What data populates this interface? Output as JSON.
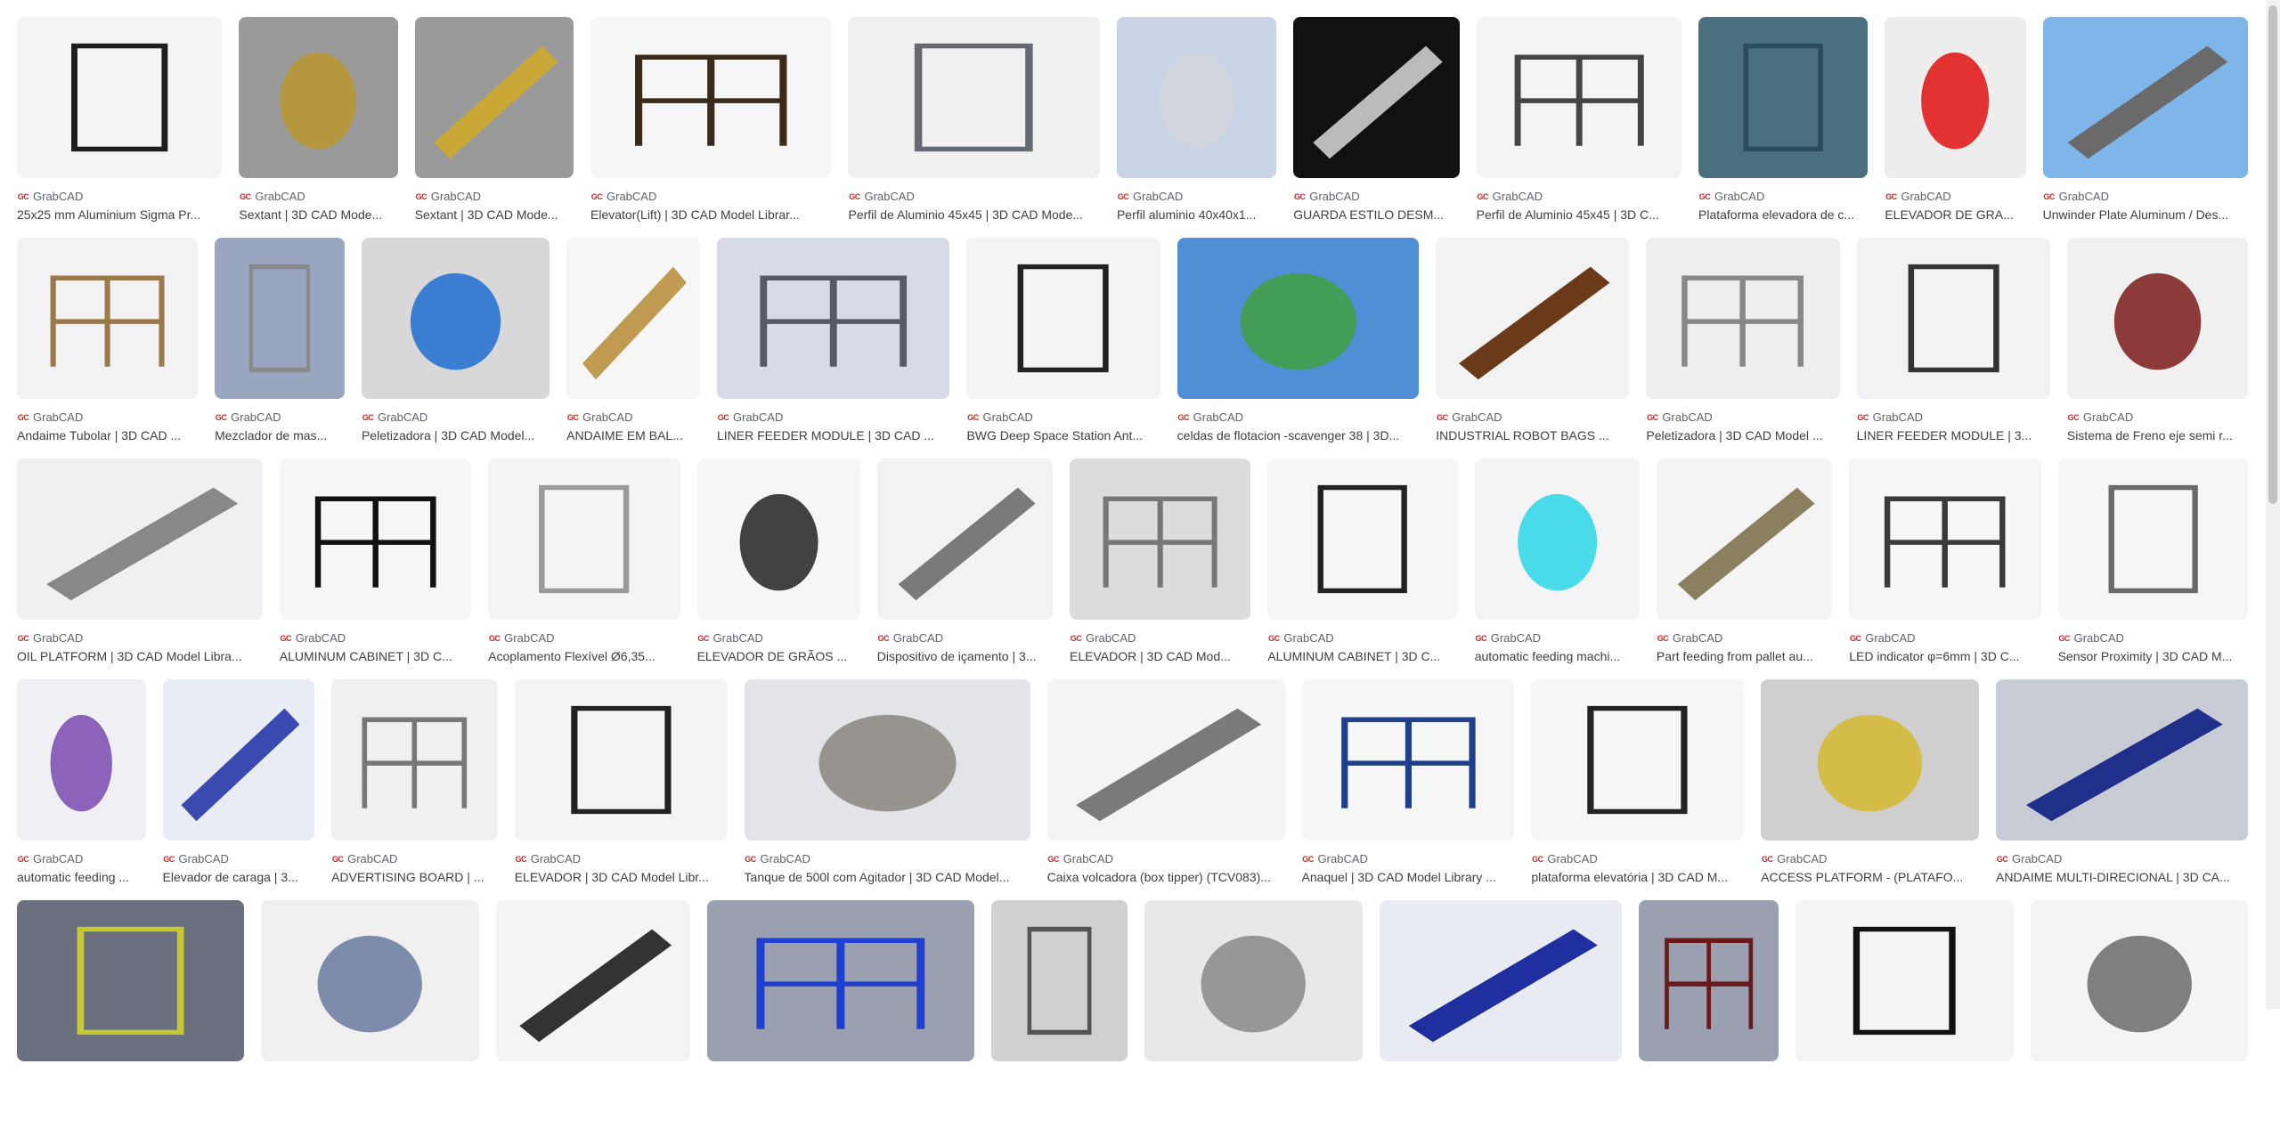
{
  "source_icon": "GC",
  "source_name": "GrabCAD",
  "colors": {
    "tile_bg": "#f3f3f3",
    "text": "#3c4043",
    "source_text": "#5f6368",
    "icon_red": "#c62828"
  },
  "rows": [
    {
      "tiles": [
        {
          "title": "25x25 mm Aluminium Sigma Pr...",
          "weight": 230,
          "bg": "#f4f4f4",
          "fg": "#1e1e1e"
        },
        {
          "title": "Sextant | 3D CAD Mode...",
          "weight": 178,
          "bg": "#9a9a9a",
          "fg": "#b8962e"
        },
        {
          "title": "Sextant | 3D CAD Mode...",
          "weight": 178,
          "bg": "#9a9a9a",
          "fg": "#c9a838"
        },
        {
          "title": "Elevator(Lift) | 3D CAD Model Librar...",
          "weight": 270,
          "bg": "#f6f6f6",
          "fg": "#3a2a1a"
        },
        {
          "title": "Perfil de Aluminio 45x45 | 3D CAD Mode...",
          "weight": 282,
          "bg": "#f0f0f0",
          "fg": "#666a70"
        },
        {
          "title": "Perfil aluminio 40x40x1...",
          "weight": 179,
          "bg": "#c8d4e6",
          "fg": "#d0d4da"
        },
        {
          "title": "GUARDA ESTILO DESM...",
          "weight": 186,
          "bg": "#111111",
          "fg": "#bbbbbb"
        },
        {
          "title": "Perfil de Aluminio 45x45 | 3D C...",
          "weight": 230,
          "bg": "#f4f4f4",
          "fg": "#444444"
        },
        {
          "title": "Plataforma elevadora de c...",
          "weight": 190,
          "bg": "#4a7080",
          "fg": "#2a4d5c"
        },
        {
          "title": "ELEVADOR DE GRA...",
          "weight": 158,
          "bg": "#ededed",
          "fg": "#e01010"
        },
        {
          "title": "Unwinder Plate Aluminum / Des...",
          "weight": 230,
          "bg": "#7fb6ea",
          "fg": "#6a6a6a"
        }
      ]
    },
    {
      "tiles": [
        {
          "title": "Andaime Tubolar | 3D CAD ...",
          "weight": 202,
          "bg": "#f2f2f4",
          "fg": "#9a7a4a"
        },
        {
          "title": "Mezclador de mas...",
          "weight": 145,
          "bg": "#9aa6c0",
          "fg": "#8a8a8a"
        },
        {
          "title": "Peletizadora | 3D CAD Model...",
          "weight": 210,
          "bg": "#d8d8d8",
          "fg": "#1f6fd0"
        },
        {
          "title": "ANDAIME EM BAL...",
          "weight": 149,
          "bg": "#f6f6f6",
          "fg": "#c09a50"
        },
        {
          "title": "LINER FEEDER MODULE | 3D CAD ...",
          "weight": 260,
          "bg": "#d6dbe6",
          "fg": "#555a66"
        },
        {
          "title": "BWG Deep Space Station Ant...",
          "weight": 216,
          "bg": "#f4f4f4",
          "fg": "#222222"
        },
        {
          "title": "celdas de flotacion -scavenger 38 | 3D...",
          "weight": 270,
          "bg": "#4f8fd6",
          "fg": "#3fa040"
        },
        {
          "title": "INDUSTRIAL ROBOT BAGS ...",
          "weight": 216,
          "bg": "#f2f2f2",
          "fg": "#6a3a1a"
        },
        {
          "title": "Peletizadora | 3D CAD Model ...",
          "weight": 216,
          "bg": "#eeeeee",
          "fg": "#888888"
        },
        {
          "title": "LINER FEEDER MODULE | 3...",
          "weight": 216,
          "bg": "#f2f2f4",
          "fg": "#333333"
        },
        {
          "title": "Sistema de Freno eje semi r...",
          "weight": 202,
          "bg": "#f0f0f0",
          "fg": "#7a1a1a"
        }
      ]
    },
    {
      "tiles": [
        {
          "title": "OIL PLATFORM | 3D CAD Model Libra...",
          "weight": 274,
          "bg": "#f0f0f2",
          "fg": "#888888"
        },
        {
          "title": "ALUMINUM CABINET | 3D C...",
          "weight": 214,
          "bg": "#f6f6f6",
          "fg": "#111111"
        },
        {
          "title": "Acoplamento Flexível Ø6,35...",
          "weight": 214,
          "bg": "#f4f4f4",
          "fg": "#9a9a9a"
        },
        {
          "title": "ELEVADOR DE GRÃOS ...",
          "weight": 182,
          "bg": "#f6f6f6",
          "fg": "#222222"
        },
        {
          "title": "Dispositivo de içamento | 3...",
          "weight": 196,
          "bg": "#f2f2f2",
          "fg": "#7a7a7a"
        },
        {
          "title": "ELEVADOR | 3D CAD Mod...",
          "weight": 202,
          "bg": "#dcdcdc",
          "fg": "#777777"
        },
        {
          "title": "ALUMINUM CABINET | 3D C...",
          "weight": 212,
          "bg": "#f6f6f6",
          "fg": "#222222"
        },
        {
          "title": "automatic feeding machi...",
          "weight": 184,
          "bg": "#f4f4f4",
          "fg": "#2ad6e6"
        },
        {
          "title": "Part feeding from pallet au...",
          "weight": 196,
          "bg": "#f4f4f4",
          "fg": "#8a8060"
        },
        {
          "title": "LED indicator φ=6mm | 3D C...",
          "weight": 214,
          "bg": "#f6f6f6",
          "fg": "#3a3a3a"
        },
        {
          "title": "Sensor Proximity | 3D CAD M...",
          "weight": 212,
          "bg": "#f6f6f6",
          "fg": "#6a6a6a"
        }
      ]
    },
    {
      "tiles": [
        {
          "title": "automatic feeding ...",
          "weight": 144,
          "bg": "#f0f0f4",
          "fg": "#7a4ab0"
        },
        {
          "title": "Elevador de caraga | 3...",
          "weight": 170,
          "bg": "#e8ecf4",
          "fg": "#3a4ab0"
        },
        {
          "title": "ADVERTISING BOARD | ...",
          "weight": 186,
          "bg": "#f0f0f0",
          "fg": "#777777"
        },
        {
          "title": "ELEVADOR | 3D CAD Model Libr...",
          "weight": 238,
          "bg": "#f4f4f4",
          "fg": "#222222"
        },
        {
          "title": "Tanque de 500l com Agitador | 3D CAD Model...",
          "weight": 320,
          "bg": "#e2e4e8",
          "fg": "#8a8680"
        },
        {
          "title": "Caixa volcadora (box tipper) (TCV083)...",
          "weight": 266,
          "bg": "#f4f4f4",
          "fg": "#7a7a7a"
        },
        {
          "title": "Anaquel | 3D CAD Model Library ...",
          "weight": 238,
          "bg": "#f6f6f6",
          "fg": "#1f3f8a"
        },
        {
          "title": "plataforma elevatória | 3D CAD M...",
          "weight": 238,
          "bg": "#f6f6f6",
          "fg": "#222222"
        },
        {
          "title": "ACCESS PLATFORM - (PLATAFO...",
          "weight": 244,
          "bg": "#cfcfcf",
          "fg": "#d4b830"
        },
        {
          "title": "ANDAIME MULTI-DIRECIONAL | 3D CA...",
          "weight": 282,
          "bg": "#c8ccd4",
          "fg": "#1f2f8a"
        }
      ]
    },
    {
      "tiles": [
        {
          "title": "",
          "weight": 240,
          "bg": "#6a7080",
          "fg": "#c8c830"
        },
        {
          "title": "",
          "weight": 230,
          "bg": "#f0f0f0",
          "fg": "#6a7aa0"
        },
        {
          "title": "",
          "weight": 206,
          "bg": "#f4f4f4",
          "fg": "#333333"
        },
        {
          "title": "",
          "weight": 282,
          "bg": "#9aa0b0",
          "fg": "#1f3fd0"
        },
        {
          "title": "",
          "weight": 144,
          "bg": "#d0d0d0",
          "fg": "#555555"
        },
        {
          "title": "",
          "weight": 230,
          "bg": "#e8e8e8",
          "fg": "#888888"
        },
        {
          "title": "",
          "weight": 256,
          "bg": "#e8ecf2",
          "fg": "#1f2fa0"
        },
        {
          "title": "",
          "weight": 148,
          "bg": "#9aa0b0",
          "fg": "#6a1a1a"
        },
        {
          "title": "",
          "weight": 230,
          "bg": "#f4f4f4",
          "fg": "#111111"
        },
        {
          "title": "",
          "weight": 230,
          "bg": "#f4f4f4",
          "fg": "#6a6a6a"
        }
      ]
    }
  ]
}
